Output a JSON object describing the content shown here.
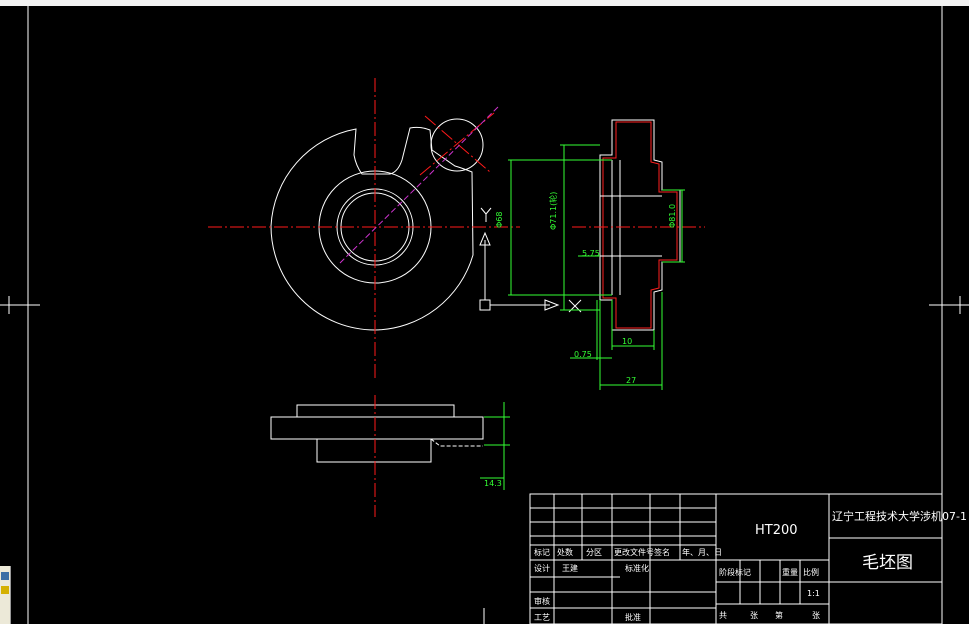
{
  "drawing": {
    "dimensions": {
      "d_left": "Φ68",
      "d_mid": "Φ71.1(轮)",
      "d_right": "Φ81.0",
      "d_575": "5.75",
      "d_10": "10",
      "d_075": "0.75",
      "d_27": "27",
      "d_143": "14.3"
    },
    "ucs": {
      "y_label": "Y",
      "x_label": "X"
    }
  },
  "title_block": {
    "material": "HT200",
    "school": "辽宁工程技术大学涉机07-1",
    "drawing_name": "毛坯图",
    "scale": "1:1",
    "labels": {
      "mark": "标记",
      "count": "处数",
      "zone": "分区",
      "change_doc": "更改文件号",
      "sign": "签名",
      "date": "年、月、日",
      "design": "设计",
      "designer": "王建",
      "standardize": "标准化",
      "review": "审核",
      "process": "工艺",
      "approve": "批准",
      "stage_mark": "阶段标记",
      "weight": "重量",
      "ratio": "比例",
      "total": "共",
      "sheets": "张",
      "page": "第",
      "sheet": "张"
    }
  },
  "colors": {
    "background": "#000000",
    "geometry": "#ffffff",
    "centerline": "#ff1a1a",
    "dimension": "#33ff33",
    "section_outline": "#ff2020",
    "diagonal": "#cc33cc"
  }
}
